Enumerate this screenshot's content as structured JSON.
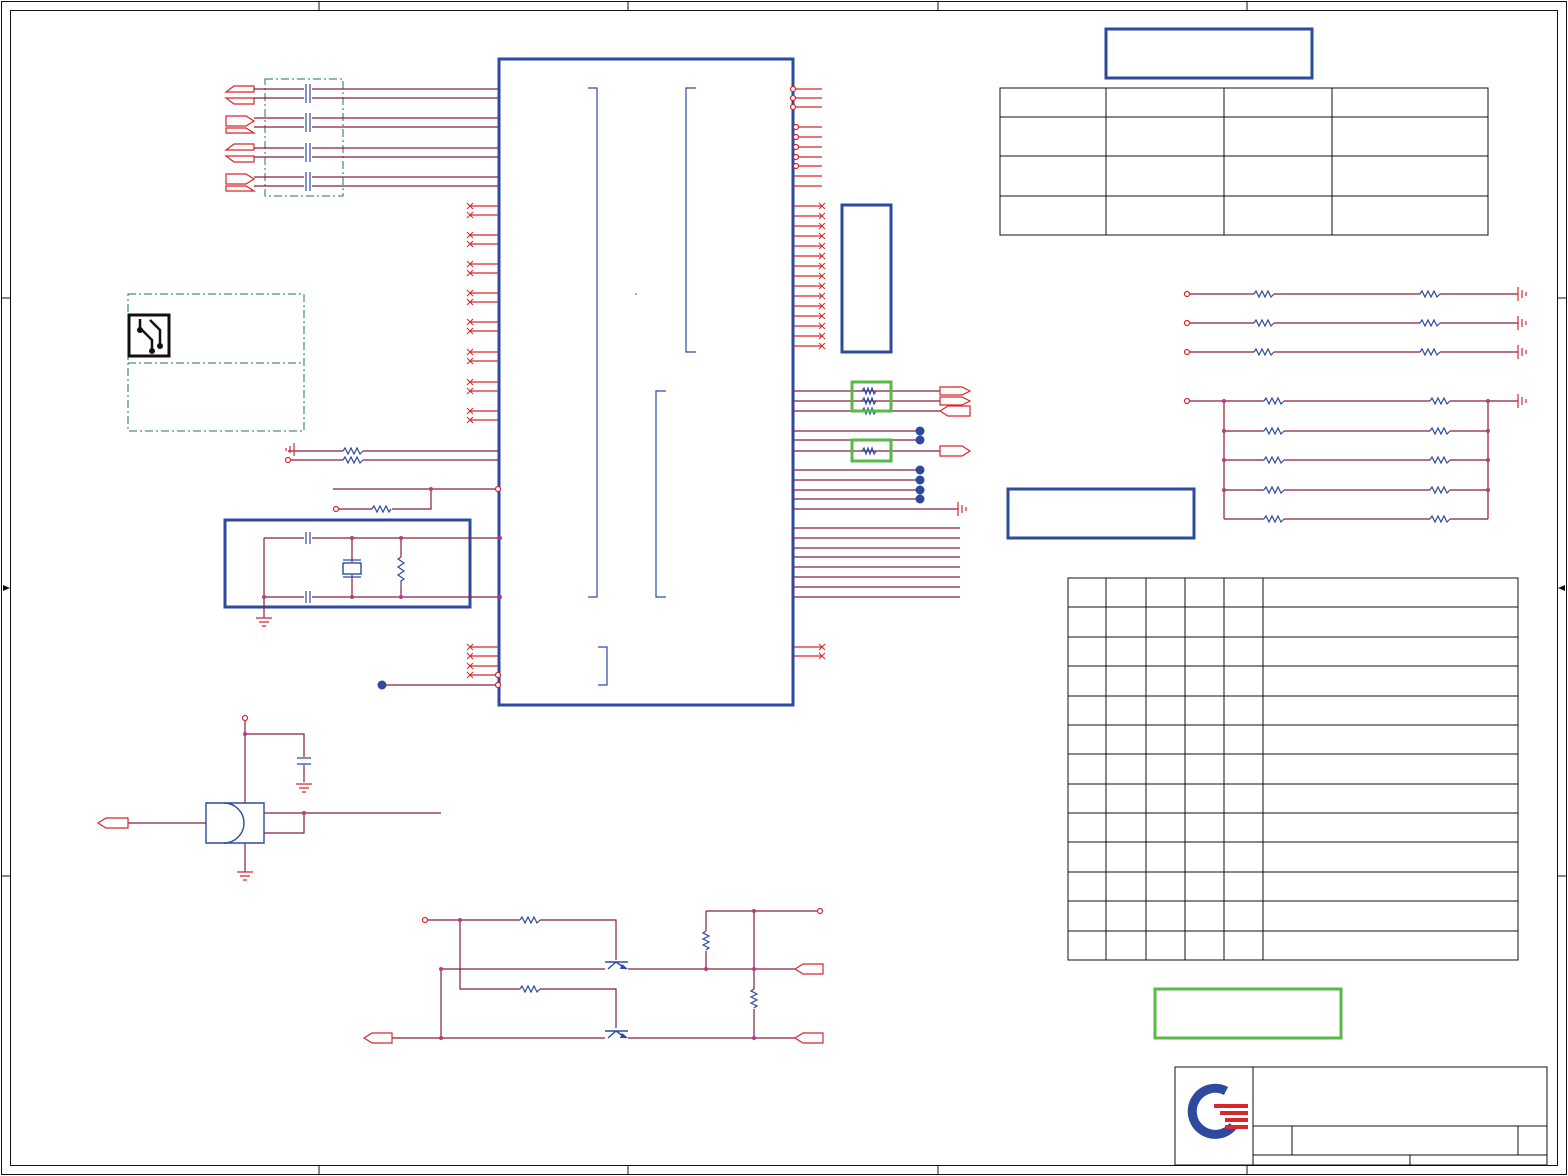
{
  "sheet": {
    "frame_color": "#111111",
    "block_color": "#2e4a9e",
    "wire_color": "#8a1e3c",
    "pin_color": "#d6282d",
    "highlight_color": "#58b947",
    "keepout_color": "#1d7a46"
  },
  "icons": {
    "pcb_warning": "pcb-trace-icon",
    "company_logo": "quanta-logo-icon"
  }
}
